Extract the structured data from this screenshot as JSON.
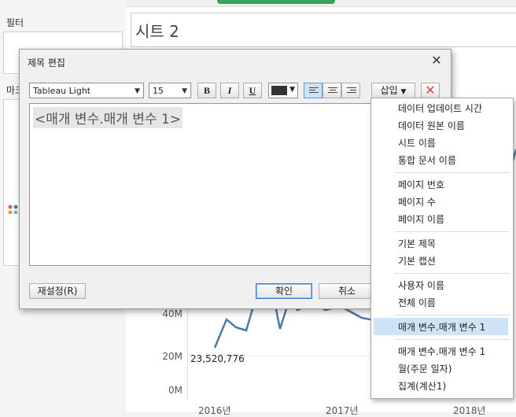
{
  "workspace": {
    "filters_title": "필터",
    "marks_title": "마크",
    "sheet_title": "시트 2",
    "axis_labels": [
      "40M",
      "20M",
      "0M"
    ],
    "year_labels": [
      "2016년",
      "2017년",
      "2018년"
    ],
    "data_label": "23,520,776"
  },
  "dialog": {
    "title": "제목 편집",
    "font_family": "Tableau Light",
    "font_size": "15",
    "bold_label": "B",
    "italic_label": "I",
    "underline_label": "U",
    "text_color": "#333333",
    "insert_label": "삽입",
    "editor_text": "<매개 변수.매개 변수 1>",
    "reset_label": "재설정(R)",
    "ok_label": "확인",
    "cancel_label": "취소"
  },
  "insert_menu": {
    "items": [
      "데이터 업데이트 시간",
      "데이터 원본 이름",
      "시트 이름",
      "통합 문서 이름",
      "페이지 번호",
      "페이지 수",
      "페이지 이름",
      "기본 제목",
      "기본 캡션",
      "사용자 이름",
      "전체 이름",
      "매개 변수.매개 변수 1",
      "매개 변수.매개 변수 1",
      "월(주문 일자)",
      "집계(계산1)"
    ],
    "highlighted_index": 11
  },
  "colors": {
    "accent": "#3c7fd0",
    "menu_highlight": "#cfe3f7",
    "chart_line": "#4e79a7",
    "delete_x": "#d9453a"
  }
}
